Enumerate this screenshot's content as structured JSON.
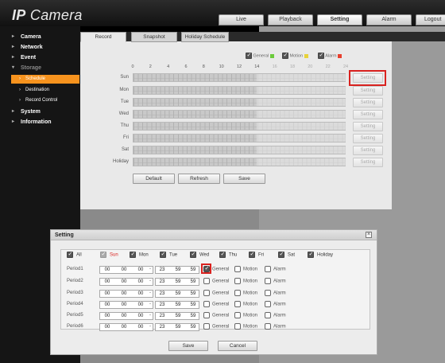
{
  "app": {
    "logo_main": "IP",
    "logo_rest": " Camera"
  },
  "top_nav": [
    "Live",
    "Playback",
    "Setting",
    "Alarm",
    "Logout"
  ],
  "sidebar": {
    "items": [
      {
        "label": "Camera"
      },
      {
        "label": "Network"
      },
      {
        "label": "Event"
      },
      {
        "label": "Storage"
      },
      {
        "label": "Schedule"
      },
      {
        "label": "Destination"
      },
      {
        "label": "Record Control"
      },
      {
        "label": "System"
      },
      {
        "label": "Information"
      }
    ]
  },
  "tabs": [
    "Record",
    "Snapshot",
    "Holiday Schedule"
  ],
  "legend": {
    "general": "General",
    "motion": "Motion",
    "alarm": "Alarm",
    "colors": {
      "general": "#6ccb3c",
      "motion": "#e8d23a",
      "alarm": "#e8402e"
    }
  },
  "hours": [
    "0",
    "2",
    "4",
    "6",
    "8",
    "10",
    "12",
    "14",
    "16",
    "18",
    "20",
    "22",
    "24"
  ],
  "days": [
    "Sun",
    "Mon",
    "Tue",
    "Wed",
    "Thu",
    "Fri",
    "Sat",
    "Holiday"
  ],
  "setting_button": "Setting",
  "panel_buttons": {
    "default": "Default",
    "refresh": "Refresh",
    "save": "Save"
  },
  "dialog": {
    "title": "Setting",
    "day_checks": [
      {
        "label": "All",
        "checked": true
      },
      {
        "label": "Sun",
        "checked": true
      },
      {
        "label": "Mon",
        "checked": true
      },
      {
        "label": "Tue",
        "checked": true
      },
      {
        "label": "Wed",
        "checked": true
      },
      {
        "label": "Thu",
        "checked": true
      },
      {
        "label": "Fri",
        "checked": true
      },
      {
        "label": "Sat",
        "checked": true
      },
      {
        "label": "Holiday",
        "checked": true
      }
    ],
    "periods": [
      {
        "label": "Period1",
        "start": [
          "00",
          "00",
          "00"
        ],
        "end": [
          "23",
          "59",
          "59"
        ],
        "general": true
      },
      {
        "label": "Period2",
        "start": [
          "00",
          "00",
          "00"
        ],
        "end": [
          "23",
          "59",
          "59"
        ],
        "general": false
      },
      {
        "label": "Period3",
        "start": [
          "00",
          "00",
          "00"
        ],
        "end": [
          "23",
          "59",
          "59"
        ],
        "general": false
      },
      {
        "label": "Period4",
        "start": [
          "00",
          "00",
          "00"
        ],
        "end": [
          "23",
          "59",
          "59"
        ],
        "general": false
      },
      {
        "label": "Period5",
        "start": [
          "00",
          "00",
          "00"
        ],
        "end": [
          "23",
          "59",
          "59"
        ],
        "general": false
      },
      {
        "label": "Period6",
        "start": [
          "00",
          "00",
          "00"
        ],
        "end": [
          "23",
          "59",
          "59"
        ],
        "general": false
      }
    ],
    "option_labels": {
      "general": "General",
      "motion": "Motion",
      "alarm": "Alarm"
    },
    "dash": "-",
    "save": "Save",
    "cancel": "Cancel",
    "close_glyph": "×"
  }
}
